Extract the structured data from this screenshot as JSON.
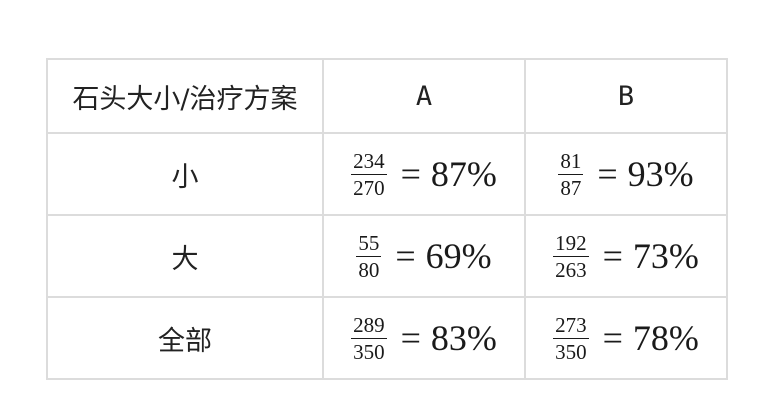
{
  "table": {
    "header": {
      "label": "石头大小/治疗方案",
      "col_a": "A",
      "col_b": "B"
    },
    "rows": [
      {
        "label": "小",
        "a": {
          "num": "234",
          "den": "270",
          "eq": "=",
          "pct": "87%"
        },
        "b": {
          "num": "81",
          "den": "87",
          "eq": "=",
          "pct": "93%"
        }
      },
      {
        "label": "大",
        "a": {
          "num": "55",
          "den": "80",
          "eq": "=",
          "pct": "69%"
        },
        "b": {
          "num": "192",
          "den": "263",
          "eq": "=",
          "pct": "73%"
        }
      },
      {
        "label": "全部",
        "a": {
          "num": "289",
          "den": "350",
          "eq": "=",
          "pct": "83%"
        },
        "b": {
          "num": "273",
          "den": "350",
          "eq": "=",
          "pct": "78%"
        }
      }
    ],
    "colors": {
      "border": "#dcdcdc",
      "text": "#222222"
    }
  }
}
